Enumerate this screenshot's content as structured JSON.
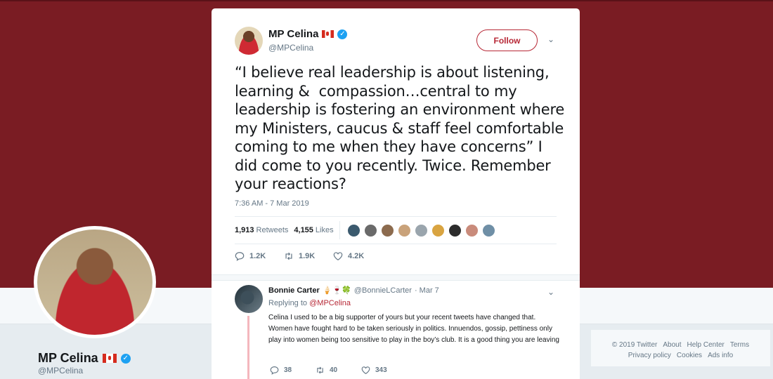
{
  "profile": {
    "name": "MP Celina",
    "handle": "@MPCelina"
  },
  "footer": {
    "links": [
      "© 2019 Twitter",
      "About",
      "Help Center",
      "Terms",
      "Privacy policy",
      "Cookies",
      "Ads info"
    ]
  },
  "tweet": {
    "author_name": "MP Celina",
    "author_handle": "@MPCelina",
    "follow_label": "Follow",
    "text": "“I believe real leadership is about listening, learning &  compassion…central to my leadership is fostering an environment where my Ministers, caucus & staff feel comfortable coming to me when they have concerns” I did come to you recently. Twice. Remember your reactions?",
    "timestamp": "7:36 AM - 7 Mar 2019",
    "retweets_count": "1,913",
    "retweets_label": "Retweets",
    "likes_count": "4,155",
    "likes_label": "Likes",
    "liker_colors": [
      "#3b5a6e",
      "#6a6a6a",
      "#8c6b4e",
      "#c9a27a",
      "#9aa5ad",
      "#d9a441",
      "#2c2c2c",
      "#c98b7b",
      "#6f8fa6"
    ],
    "reply_count": "1.2K",
    "retweet_action_count": "1.9K",
    "like_action_count": "4.2K"
  },
  "reply": {
    "name": "Bonnie Carter",
    "emoji": "🍦🍷🍀",
    "handle": "@BonnieLCarter",
    "date": "· Mar 7",
    "replying_prefix": "Replying to",
    "replying_to": "@MPCelina",
    "text": "Celina I used to be a big supporter of yours but your recent tweets have changed that. Women have fought hard to be taken seriously in politics.  Innuendos, gossip, pettiness only play into women being too sensitive to play in the boy’s club. It is a good thing you are leaving",
    "reply_count": "38",
    "retweet_count": "40",
    "like_count": "343"
  },
  "colors": {
    "banner": "#7a1c23",
    "accent": "#b72836",
    "verified": "#1da1f2"
  }
}
